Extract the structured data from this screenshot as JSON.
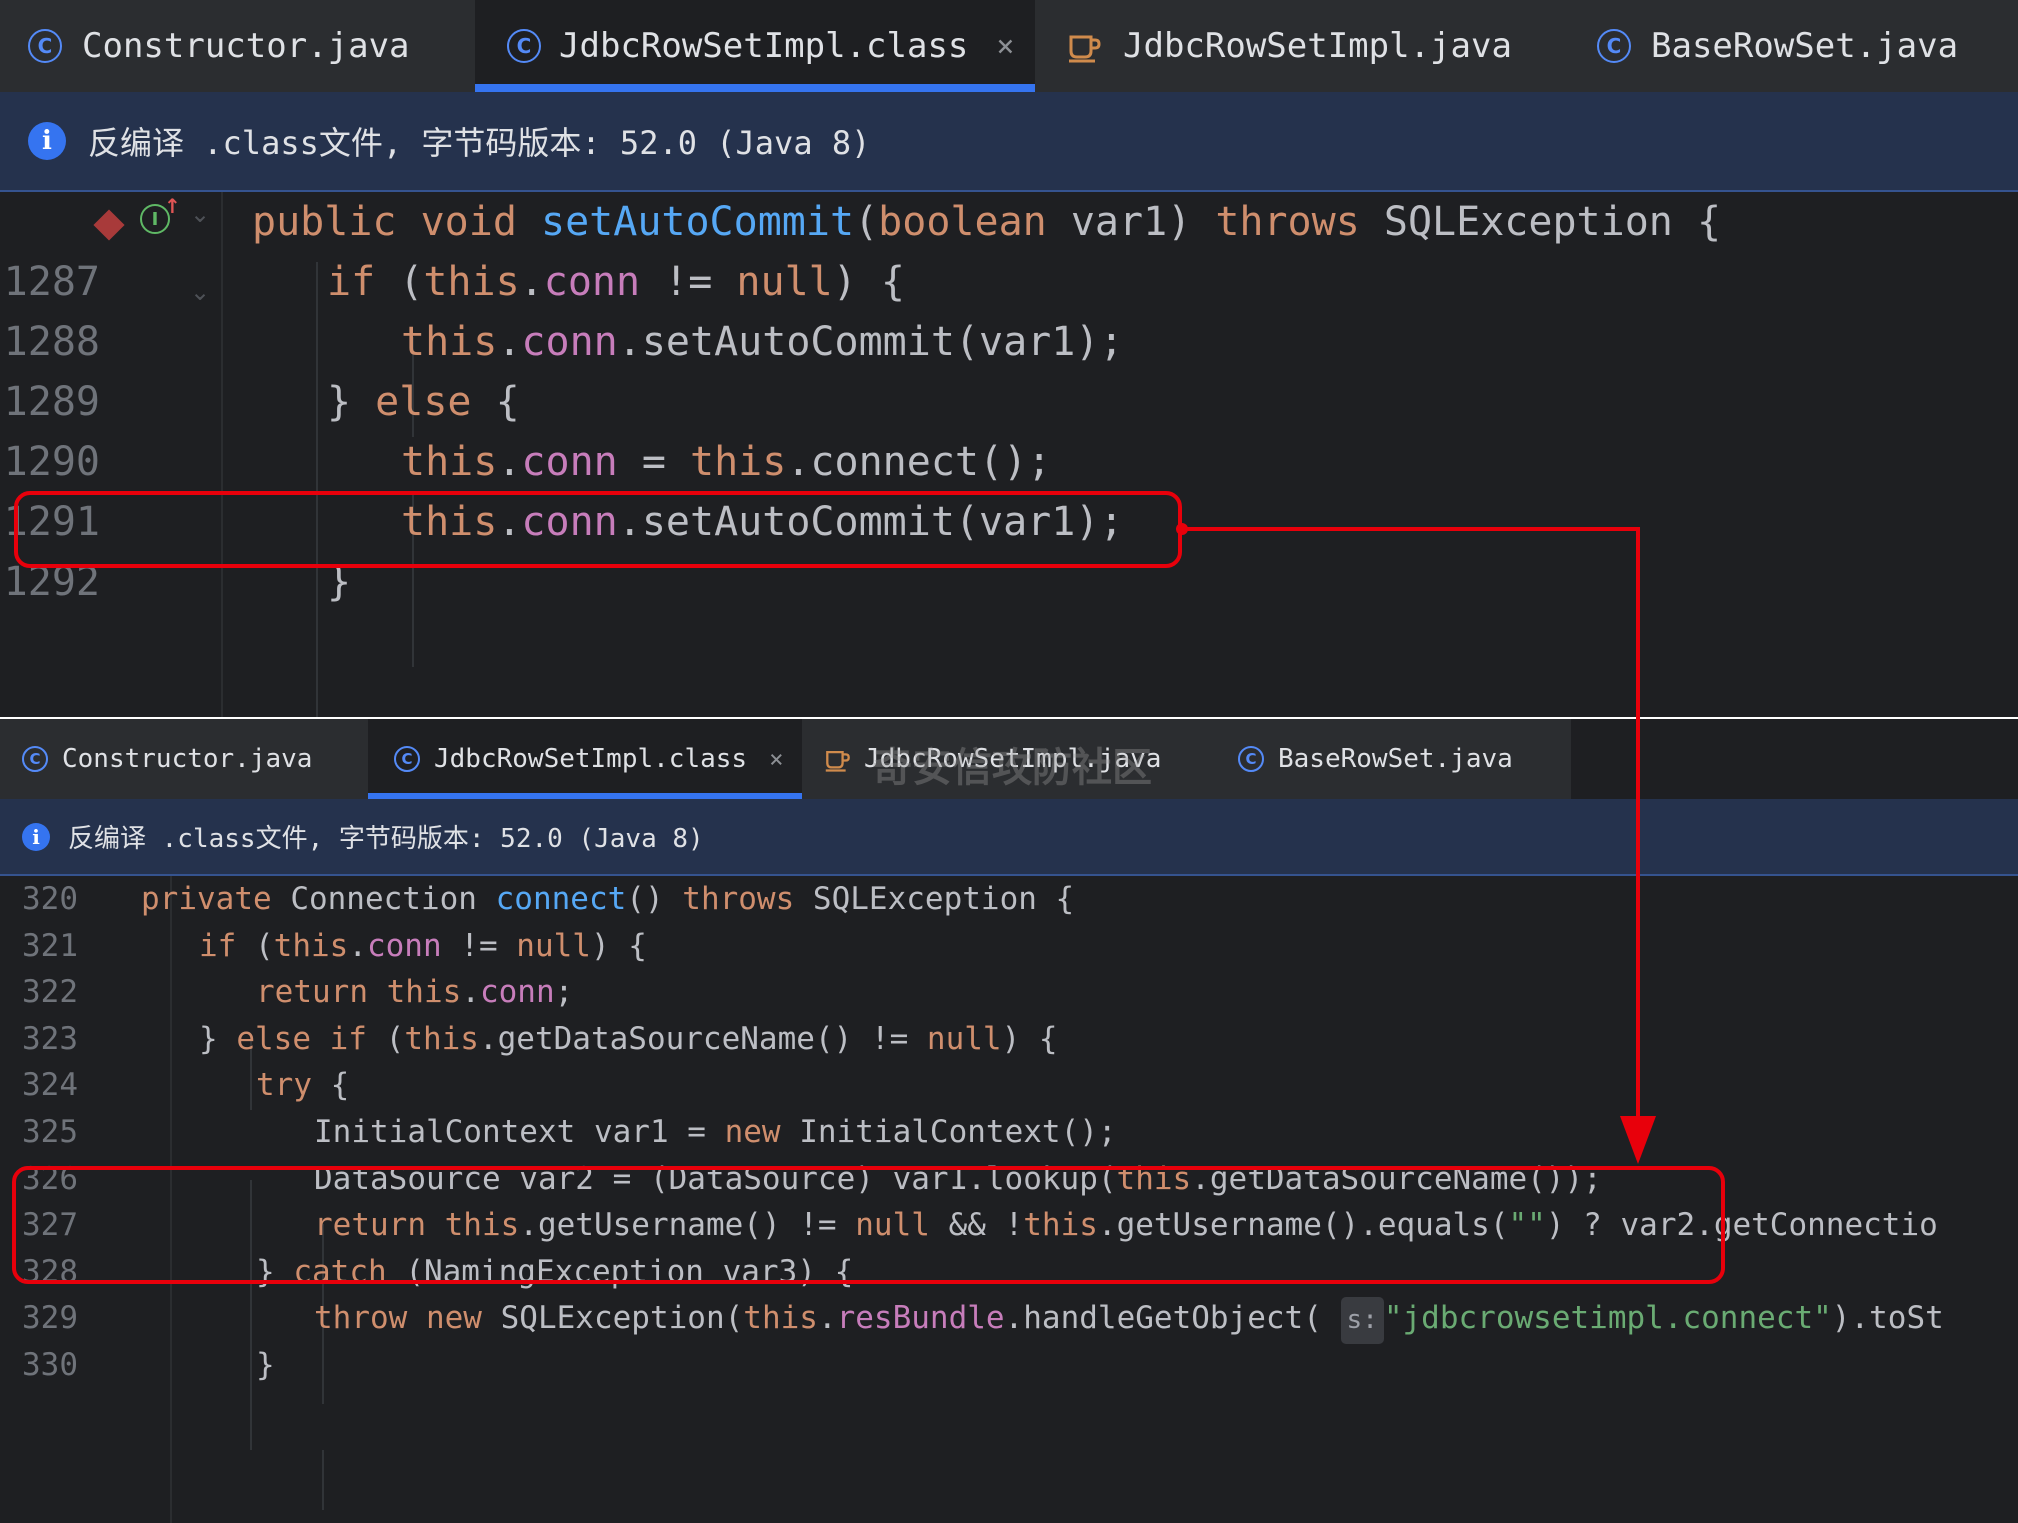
{
  "panel1": {
    "tabs": [
      {
        "label": "Constructor.java",
        "icon": "class-icon"
      },
      {
        "label": "JdbcRowSetImpl.class",
        "icon": "class-icon",
        "close": "×"
      },
      {
        "label": "JdbcRowSetImpl.java",
        "icon": "java-file-icon"
      },
      {
        "label": "BaseRowSet.java",
        "icon": "class-icon"
      }
    ],
    "info": "反编译 .class文件, 字节码版本: 52.0 (Java 8)",
    "gutter": {
      "impl_marker": "I",
      "override_arrow": "↑",
      "fold": "⌄"
    },
    "lines": [
      {
        "n": "",
        "tokens": [
          [
            "kw",
            "public void "
          ],
          [
            "fn",
            "setAutoCommit"
          ],
          [
            "",
            "("
          ],
          [
            "kw",
            "boolean"
          ],
          [
            "",
            " var1) "
          ],
          [
            "kw",
            "throws"
          ],
          [
            "",
            " SQLException {"
          ]
        ]
      },
      {
        "n": "1287",
        "tokens": [
          [
            "kw",
            "if"
          ],
          [
            "",
            " ("
          ],
          [
            "kw",
            "this"
          ],
          [
            "",
            "."
          ],
          [
            "fld",
            "conn"
          ],
          [
            "",
            " != "
          ],
          [
            "kw",
            "null"
          ],
          [
            "",
            ") {"
          ]
        ]
      },
      {
        "n": "1288",
        "tokens": [
          [
            "kw",
            "this"
          ],
          [
            "",
            "."
          ],
          [
            "fld",
            "conn"
          ],
          [
            "",
            ".setAutoCommit(var1);"
          ]
        ]
      },
      {
        "n": "1289",
        "tokens": [
          [
            "",
            "} "
          ],
          [
            "kw",
            "else"
          ],
          [
            "",
            " {"
          ]
        ]
      },
      {
        "n": "1290",
        "tokens": [
          [
            "kw",
            "this"
          ],
          [
            "",
            "."
          ],
          [
            "fld",
            "conn"
          ],
          [
            "",
            " = "
          ],
          [
            "kw",
            "this"
          ],
          [
            "",
            ".connect();"
          ]
        ]
      },
      {
        "n": "1291",
        "tokens": [
          [
            "kw",
            "this"
          ],
          [
            "",
            "."
          ],
          [
            "fld",
            "conn"
          ],
          [
            "",
            ".setAutoCommit(var1);"
          ]
        ]
      },
      {
        "n": "1292",
        "tokens": [
          [
            "",
            "}"
          ]
        ]
      }
    ]
  },
  "panel2": {
    "tabs": [
      {
        "label": "Constructor.java",
        "icon": "class-icon"
      },
      {
        "label": "JdbcRowSetImpl.class",
        "icon": "class-icon",
        "close": "×"
      },
      {
        "label": "JdbcRowSetImpl.java",
        "icon": "java-file-icon"
      },
      {
        "label": "BaseRowSet.java",
        "icon": "class-icon"
      }
    ],
    "info": "反编译 .class文件, 字节码版本: 52.0 (Java 8)",
    "watermark": "奇安信攻防社区",
    "lines": [
      {
        "n": "320",
        "tokens": [
          [
            "kw",
            "private"
          ],
          [
            "",
            " Connection "
          ],
          [
            "fn",
            "connect"
          ],
          [
            "",
            "() "
          ],
          [
            "kw",
            "throws"
          ],
          [
            "",
            " SQLException {"
          ]
        ]
      },
      {
        "n": "321",
        "tokens": [
          [
            "kw",
            "if"
          ],
          [
            "",
            " ("
          ],
          [
            "kw",
            "this"
          ],
          [
            "",
            "."
          ],
          [
            "fld",
            "conn"
          ],
          [
            "",
            " != "
          ],
          [
            "kw",
            "null"
          ],
          [
            "",
            ") {"
          ]
        ]
      },
      {
        "n": "322",
        "tokens": [
          [
            "kw",
            "return this"
          ],
          [
            "",
            "."
          ],
          [
            "fld",
            "conn"
          ],
          [
            "",
            ";"
          ]
        ]
      },
      {
        "n": "323",
        "tokens": [
          [
            "",
            "} "
          ],
          [
            "kw",
            "else if"
          ],
          [
            "",
            " ("
          ],
          [
            "kw",
            "this"
          ],
          [
            "",
            ".getDataSourceName() != "
          ],
          [
            "kw",
            "null"
          ],
          [
            "",
            ") {"
          ]
        ]
      },
      {
        "n": "324",
        "tokens": [
          [
            "kw",
            "try"
          ],
          [
            "",
            " {"
          ]
        ]
      },
      {
        "n": "325",
        "tokens": [
          [
            "",
            "InitialContext var1 = "
          ],
          [
            "kw",
            "new"
          ],
          [
            "",
            " InitialContext();"
          ]
        ]
      },
      {
        "n": "326",
        "tokens": [
          [
            "",
            "DataSource var2 = (DataSource) var1.lookup("
          ],
          [
            "kw",
            "this"
          ],
          [
            "",
            ".getDataSourceName());"
          ]
        ]
      },
      {
        "n": "327",
        "tokens": [
          [
            "kw",
            "return this"
          ],
          [
            "",
            ".getUsername() != "
          ],
          [
            "kw",
            "null"
          ],
          [
            "",
            " && !"
          ],
          [
            "kw",
            "this"
          ],
          [
            "",
            ".getUsername().equals("
          ],
          [
            "str",
            "\"\""
          ],
          [
            "",
            ") ? var2.getConnectio"
          ]
        ]
      },
      {
        "n": "328",
        "tokens": [
          [
            "",
            "} "
          ],
          [
            "kw",
            "catch"
          ],
          [
            "",
            " (NamingException var3) {"
          ]
        ]
      },
      {
        "n": "329",
        "tokens": [
          [
            "kw",
            "throw new"
          ],
          [
            "",
            " SQLException("
          ],
          [
            "kw",
            "this"
          ],
          [
            "",
            "."
          ],
          [
            "fld",
            "resBundle"
          ],
          [
            "",
            ".handleGetObject( "
          ],
          [
            "hint",
            "s:"
          ],
          [
            "",
            ""
          ],
          [
            "str",
            "\"jdbcrowsetimpl.connect\""
          ],
          [
            "",
            ").toSt"
          ]
        ]
      },
      {
        "n": "330",
        "tokens": [
          [
            "",
            "}"
          ]
        ]
      }
    ]
  },
  "colors": {
    "highlight": "#e8000b",
    "keyword": "#cf8e6d",
    "field": "#c77dbb",
    "method_decl": "#56a8f5",
    "string": "#6aab73"
  }
}
